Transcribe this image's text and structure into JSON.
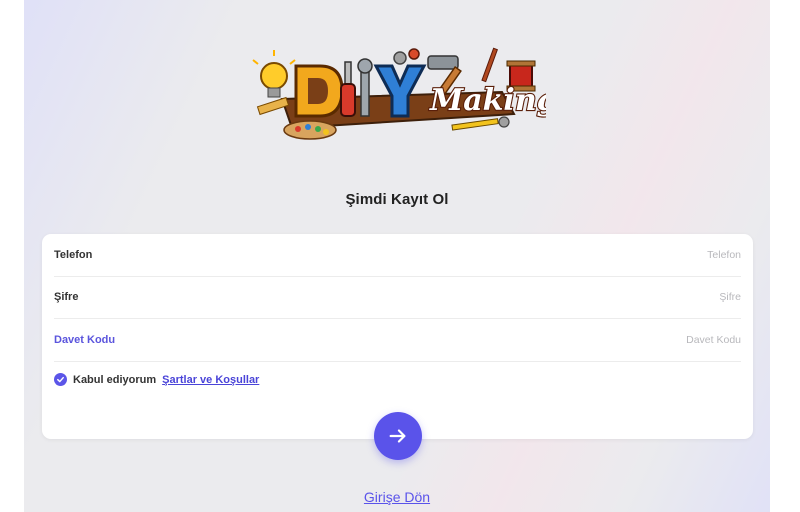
{
  "logo": {
    "text_diy": "DIY",
    "text_making": "Making"
  },
  "form": {
    "title": "Şimdi Kayıt Ol",
    "fields": [
      {
        "label": "Telefon",
        "placeholder": "Telefon",
        "value": ""
      },
      {
        "label": "Şifre",
        "placeholder": "Şifre",
        "value": ""
      },
      {
        "label": "Davet Kodu",
        "placeholder": "Davet Kodu",
        "value": ""
      }
    ],
    "agree_text": "Kabul ediyorum",
    "terms_link": "Şartlar ve Koşullar",
    "checkbox_checked": true,
    "submit_icon": "arrow-right-icon"
  },
  "footer": {
    "back_link": "Girişe Dön"
  },
  "colors": {
    "accent": "#5a53ea",
    "accent_label": "#5b55dd",
    "background": "#ebebee",
    "card": "#ffffff"
  }
}
